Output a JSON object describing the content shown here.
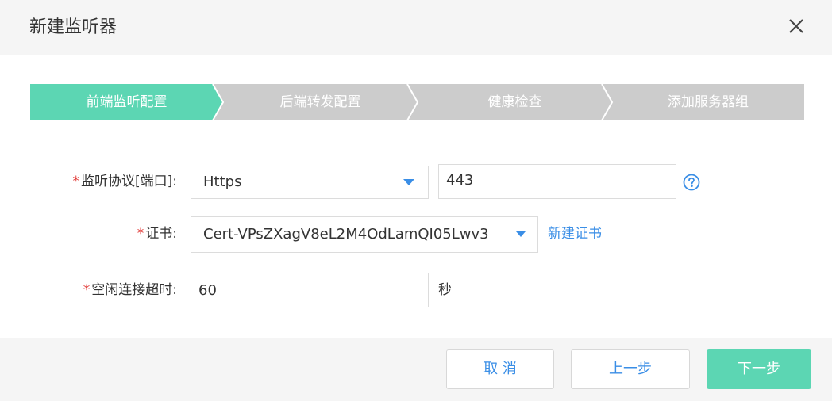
{
  "dialog": {
    "title": "新建监听器",
    "close_icon": "close-icon"
  },
  "steps": [
    {
      "label": "前端监听配置",
      "active": true
    },
    {
      "label": "后端转发配置",
      "active": false
    },
    {
      "label": "健康检查",
      "active": false
    },
    {
      "label": "添加服务器组",
      "active": false
    }
  ],
  "form": {
    "protocol_port": {
      "required_mark": "*",
      "label": "监听协议[端口]:",
      "protocol_value": "Https",
      "port_value": "443",
      "help_icon": "question-circle-icon"
    },
    "certificate": {
      "required_mark": "*",
      "label": "证书:",
      "value": "Cert-VPsZXagV8eL2M4OdLamQI05Lwv3",
      "new_cert_link": "新建证书"
    },
    "idle_timeout": {
      "required_mark": "*",
      "label": "空闲连接超时:",
      "value": "60",
      "unit": "秒"
    }
  },
  "footer": {
    "cancel_label": "取 消",
    "prev_label": "上一步",
    "next_label": "下一步"
  },
  "colors": {
    "active_step": "#5cd6b3",
    "inactive_step": "#cccccc",
    "accent": "#3a8ee6",
    "required": "#e23c39"
  }
}
